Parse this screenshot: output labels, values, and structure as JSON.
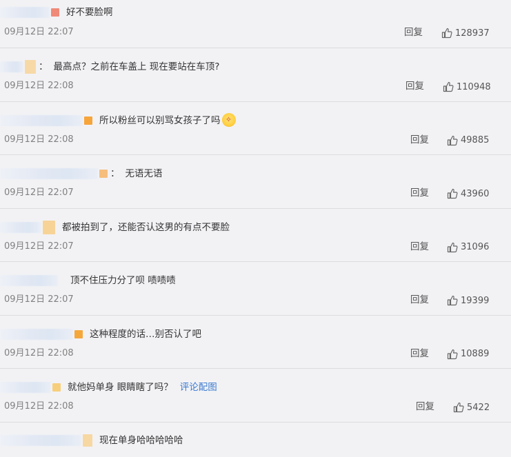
{
  "comments": [
    {
      "text": "好不要脸啊",
      "prefix": "",
      "time": "09月12日 22:07",
      "reply_label": "回复",
      "likes": "128937",
      "avatar_color": "#ef8a78"
    },
    {
      "text": "最高点？之前在车盖上 现在要站在车顶?",
      "prefix": "：",
      "time": "09月12日 22:08",
      "reply_label": "回复",
      "likes": "110948",
      "avatar_color": "#f7d9a8"
    },
    {
      "text": "所以粉丝可以别骂女孩子了吗",
      "prefix": "",
      "time": "09月12日 22:08",
      "reply_label": "回复",
      "likes": "49885",
      "avatar_color": "#f6a53b",
      "emoji": "crying-face-emoji"
    },
    {
      "text": "无语无语",
      "prefix": "：",
      "time": "09月12日 22:07",
      "reply_label": "回复",
      "likes": "43960",
      "avatar_color": "#f6be7d"
    },
    {
      "text": "都被拍到了，还能否认这男的有点不要脸",
      "prefix": "",
      "time": "09月12日 22:07",
      "reply_label": "回复",
      "likes": "31096",
      "avatar_color": "#f7d398"
    },
    {
      "text": "顶不住压力分了呗 啧啧啧",
      "prefix": "",
      "time": "09月12日 22:07",
      "reply_label": "回复",
      "likes": "19399",
      "avatar_color": "#dfe6f2"
    },
    {
      "text": "这种程度的话…别否认了吧",
      "prefix": "",
      "time": "09月12日 22:08",
      "reply_label": "回复",
      "likes": "10889",
      "avatar_color": "#f4a83c"
    },
    {
      "text": "就他妈单身 眼睛瞎了吗？",
      "prefix": "",
      "link": "评论配图",
      "time": "09月12日 22:08",
      "reply_label": "回复",
      "likes": "5422",
      "avatar_color": "#f7cf7c"
    },
    {
      "text": "现在单身哈哈哈哈哈",
      "prefix": "",
      "time": "",
      "reply_label": "",
      "likes": "",
      "avatar_color": "#f7d8a3"
    }
  ],
  "icons": {
    "like": "thumbs-up-icon"
  }
}
